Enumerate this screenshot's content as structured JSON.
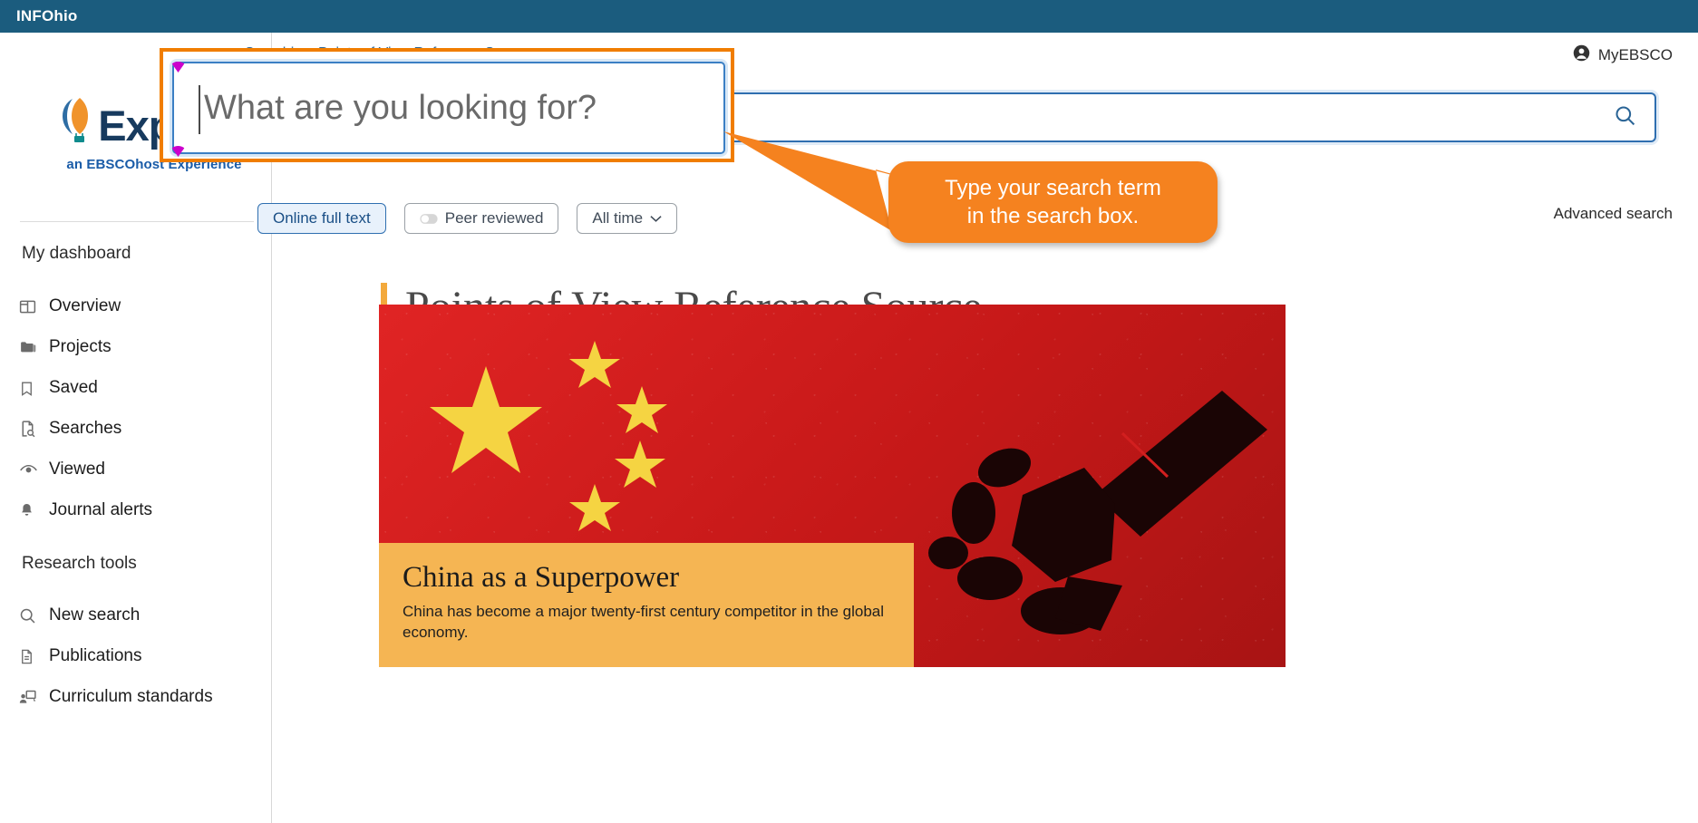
{
  "topbar": {
    "brand": "INFOhio"
  },
  "logo": {
    "word": "Explora",
    "subtitle": "an EBSCOhost Experience"
  },
  "header": {
    "breadcrumb": "Searching: Points of View Reference Source",
    "myebsco_label": "MyEBSCO",
    "myebsco_icon": "account-circle-icon",
    "advanced_search": "Advanced search"
  },
  "search": {
    "placeholder": "What are you looking for?",
    "value": "",
    "search_icon": "search-icon"
  },
  "filters": [
    {
      "label": "Online full text",
      "active": true,
      "icon": ""
    },
    {
      "label": "Peer reviewed",
      "active": false,
      "icon": "toggle-icon"
    },
    {
      "label": "All time",
      "active": false,
      "icon": "chevron-down-icon"
    }
  ],
  "sidebar": {
    "groups": [
      {
        "title": "My dashboard",
        "items": [
          {
            "label": "Overview",
            "icon": "layout-dashboard-icon"
          },
          {
            "label": "Projects",
            "icon": "folder-icon"
          },
          {
            "label": "Saved",
            "icon": "bookmark-icon"
          },
          {
            "label": "Searches",
            "icon": "document-search-icon"
          },
          {
            "label": "Viewed",
            "icon": "eye-icon"
          },
          {
            "label": "Journal alerts",
            "icon": "bell-icon"
          }
        ]
      },
      {
        "title": "Research tools",
        "items": [
          {
            "label": "New search",
            "icon": "search-icon"
          },
          {
            "label": "Publications",
            "icon": "document-icon"
          },
          {
            "label": "Curriculum standards",
            "icon": "presentation-user-icon"
          }
        ]
      }
    ]
  },
  "main": {
    "page_title": "Points of View Reference Source",
    "hero": {
      "title": "China as a Superpower",
      "description": "China has become a major twenty-first century competitor in the global economy.",
      "image_alt": "China flag with satellite silhouette"
    }
  },
  "annotation": {
    "callout_text": "Type your search term in the search box.",
    "callout_line1": "Type your search term",
    "callout_line2": "in the search box.",
    "zoom_box_placeholder": "What are you looking for?"
  },
  "colors": {
    "topbar": "#1b5c7e",
    "accent_orange": "#f5821f",
    "zoom_border": "#f07d00",
    "link_blue": "#2a6496",
    "handle_magenta": "#cc00cc",
    "hero_red": "#d21f1f",
    "hero_caption": "#f5b553",
    "title_accent": "#f3a93c"
  }
}
